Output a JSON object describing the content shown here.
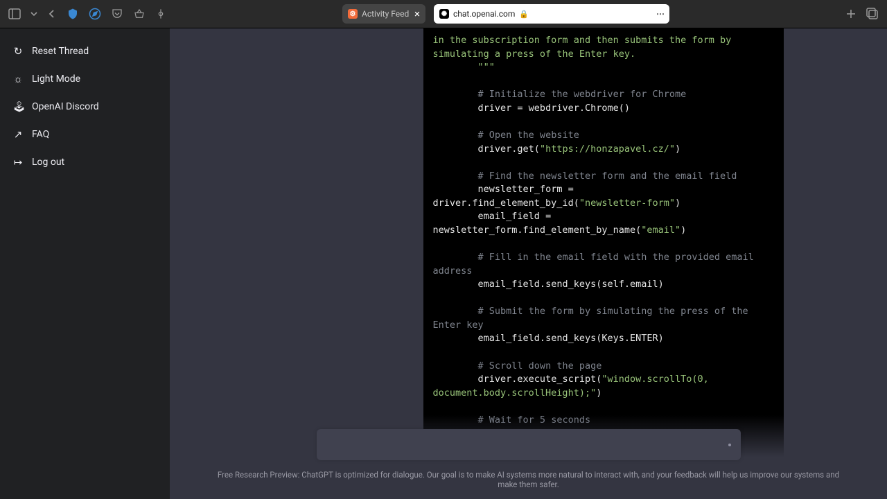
{
  "browser": {
    "tabs": [
      {
        "label": "Activity Feed"
      },
      {
        "label": "chat.openai.com"
      }
    ]
  },
  "sidebar": {
    "items": [
      {
        "label": "Reset Thread"
      },
      {
        "label": "Light Mode"
      },
      {
        "label": "OpenAI Discord"
      },
      {
        "label": "FAQ"
      },
      {
        "label": "Log out"
      }
    ]
  },
  "code": {
    "l0a": "in the subscription form and then submits the form by simulating ",
    "l0b": "a press of the Enter key.",
    "l1": "        \"\"\"",
    "c1": "        # Initialize the webdriver for Chrome",
    "l2": "        driver = webdriver.Chrome()",
    "c2": "        # Open the website",
    "l3a": "        driver.get(",
    "l3b": "\"https://honzapavel.cz/\"",
    "l3c": ")",
    "c3": "        # Find the newsletter form and the email field",
    "l4a": "        newsletter_form = driver.find_element_by_id(",
    "l4b": "\"newsletter-form\"",
    "l4c": ")",
    "l5a": "        email_field = newsletter_form.find_element_by_name(",
    "l5b": "\"email\"",
    "l5c": ")",
    "c4": "        # Fill in the email field with the provided email address",
    "l6": "        email_field.send_keys(self.email)",
    "c5": "        # Submit the form by simulating the press of the Enter key",
    "l7": "        email_field.send_keys(Keys.ENTER)",
    "c6": "        # Scroll down the page",
    "l8a": "        driver.execute_script(",
    "l8b": "\"window.scrollTo(0, ",
    "l8c": "document.body.scrollHeight);\"",
    "l8d": ")",
    "c7": "        # Wait for 5 seconds"
  },
  "input": {
    "placeholder": ""
  },
  "disclaimer": "Free Research Preview: ChatGPT is optimized for dialogue. Our goal is to make AI systems more natural to interact with, and your feedback will help us improve our systems and make them safer."
}
